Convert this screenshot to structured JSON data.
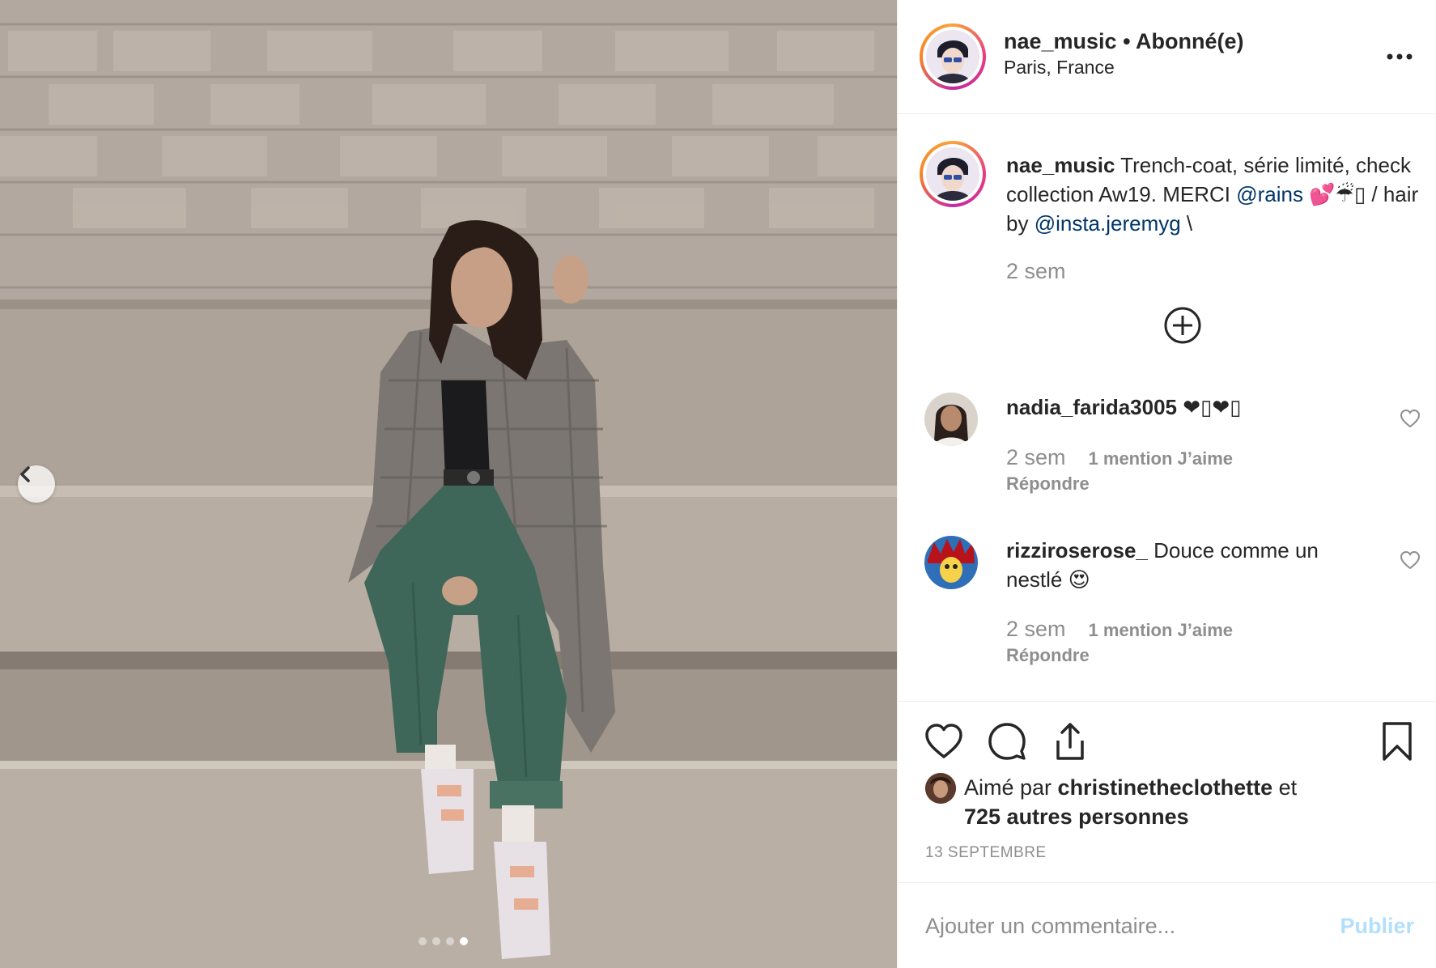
{
  "post": {
    "image_alt": "Woman in plaid trench coat sitting on stone bench",
    "carousel": {
      "count": 4,
      "active": 4
    }
  },
  "header": {
    "username": "nae_music",
    "separator": " • ",
    "follow_status": "Abonné(e)",
    "location": "Paris, France"
  },
  "caption": {
    "username": "nae_music",
    "text_1": " Trench-coat, série limité, check collection Aw19. MERCI ",
    "mention_1": "@rains",
    "text_2": " 💕☔▯ / hair by ",
    "mention_2": "@insta.jeremyg",
    "text_3": " \\",
    "time": "2 sem"
  },
  "comments": [
    {
      "username": "nadia_farida3005",
      "text": " ❤▯❤▯",
      "time": "2 sem",
      "likes": "1 mention J’aime",
      "reply": "Répondre"
    },
    {
      "username": "rizziroserose_",
      "text": " Douce comme un nestlé 😍",
      "time": "2 sem",
      "likes": "1 mention J’aime",
      "reply": "Répondre"
    }
  ],
  "likes": {
    "prefix": "Aimé par ",
    "user": "christinetheclothette",
    "suffix": " et",
    "others": "725 autres personnes"
  },
  "date": "13 SEPTEMBRE",
  "add_comment": {
    "placeholder": "Ajouter un commentaire...",
    "publish": "Publier"
  }
}
